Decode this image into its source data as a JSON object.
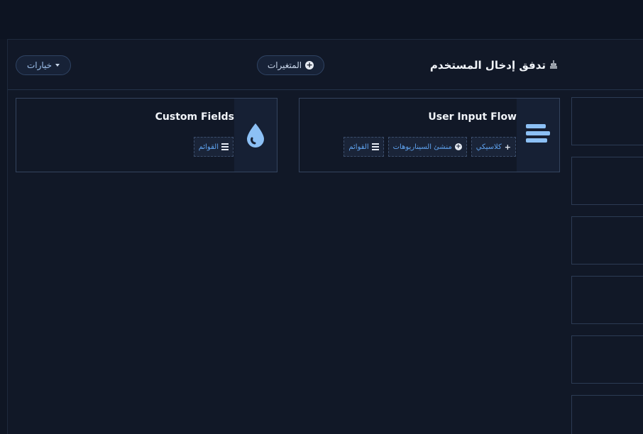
{
  "header": {
    "title": "تدفق إدخال المستخدم",
    "title_icon": "layers-icon",
    "options_label": "خيارات",
    "variables_label": "المتغيرات"
  },
  "cards": [
    {
      "title": "User Input Flow",
      "icon": "bars-icon",
      "tags": [
        "كلاسيكي",
        "منشئ السيناريوهات",
        "القوائم"
      ]
    },
    {
      "title": "Custom Fields",
      "icon": "droplet-icon",
      "tags": [
        "القوائم"
      ]
    }
  ],
  "colors": {
    "background": "#111827",
    "accent": "#5fa3f0",
    "icon": "#8cc0f5"
  }
}
